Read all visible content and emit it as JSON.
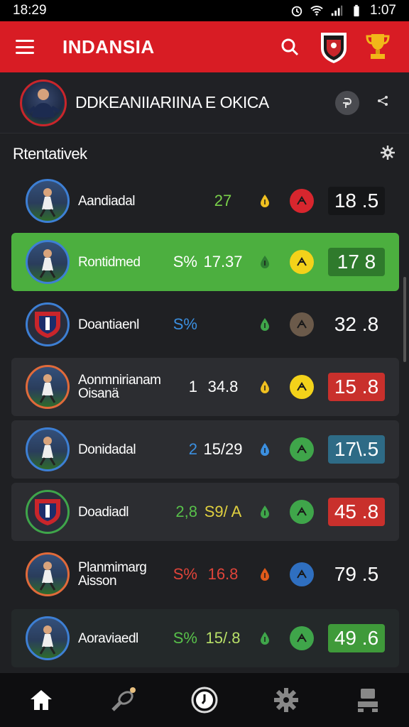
{
  "status_bar": {
    "time": "18:29",
    "clock": "1:07"
  },
  "app_bar": {
    "title": "INDANSIA",
    "icons": [
      "menu-icon",
      "search-icon",
      "club-crest-icon",
      "trophy-icon"
    ]
  },
  "profile": {
    "name": "DDKEANIIARIINA E OKICA",
    "action_icon": "info-icon",
    "share_icon": "share-icon"
  },
  "section": {
    "title": "Rtentativek",
    "icon": "settings-icon"
  },
  "rows": [
    {
      "name": "Aandiadal",
      "s1": "",
      "s2": "27",
      "s2_color": "#7ad14a",
      "ind_color": "#f0c020",
      "badge_color": "#d8262e",
      "score": "18 .5",
      "score_bg": "#151618",
      "style": "plain",
      "avatar": "player-photo"
    },
    {
      "name": "Rontidmed",
      "s1": "S%",
      "s1_color": "#ffffff",
      "s2": "17.37",
      "s2_color": "#ffffff",
      "ind_color": "#2e7d32",
      "badge_color": "#f3d21a",
      "score": "17 8",
      "score_bg": "#2f7a2c",
      "style": "active",
      "avatar": "player-photo"
    },
    {
      "name": "Doantiaenl",
      "s1": "S%",
      "s1_color": "#3b8fe0",
      "s2": "",
      "s2_color": "#ffffff",
      "ind_color": "#3fa54a",
      "badge_color": "#6b5a4a",
      "score": "32 .8",
      "score_bg": "transparent",
      "style": "plain",
      "avatar": "club-crest"
    },
    {
      "name": "Aonmnirianam Oisanä",
      "s1": "1",
      "s1_color": "#ffffff",
      "s2": "34.8",
      "s2_color": "#ffffff",
      "ind_color": "#f0c020",
      "badge_color": "#f3d21a",
      "score": "15 .8",
      "score_bg": "#c9302c",
      "style": "card",
      "avatar": "player-photo"
    },
    {
      "name": "Donidadal",
      "s1": "2",
      "s1_color": "#3b8fe0",
      "s2": "15/29",
      "s2_color": "#ffffff",
      "ind_color": "#3b8fe0",
      "badge_color": "#3fa54a",
      "score": "17\\.5",
      "score_bg": "#2e6b86",
      "style": "card",
      "avatar": "player-photo"
    },
    {
      "name": "Doadiadl",
      "s1": "2,8",
      "s1_color": "#58c04a",
      "s2": "S9/ A",
      "s2_color": "#e0d040",
      "ind_color": "#3fa54a",
      "badge_color": "#3fa54a",
      "score": "45 .8",
      "score_bg": "#c9302c",
      "style": "card",
      "avatar": "club-crest"
    },
    {
      "name": "Planmimarg Aisson",
      "s1": "S%",
      "s1_color": "#e0443a",
      "s2": "16.8",
      "s2_color": "#e0443a",
      "ind_color": "#e05a1a",
      "badge_color": "#2f6fc0",
      "score": "79 .5",
      "score_bg": "transparent",
      "style": "plain",
      "avatar": "player-photo"
    },
    {
      "name": "Aoraviaedl",
      "s1": "S%",
      "s1_color": "#58c04a",
      "s2": "15/.8",
      "s2_color": "#b8e068",
      "ind_color": "#3fa54a",
      "badge_color": "#3fa54a",
      "score": "49 .6",
      "score_bg": "#3f9a3a",
      "style": "dark",
      "avatar": "player-photo"
    }
  ],
  "bottom_nav": [
    "home-icon",
    "stats-icon",
    "clock-icon",
    "settings-icon",
    "profile-icon"
  ]
}
